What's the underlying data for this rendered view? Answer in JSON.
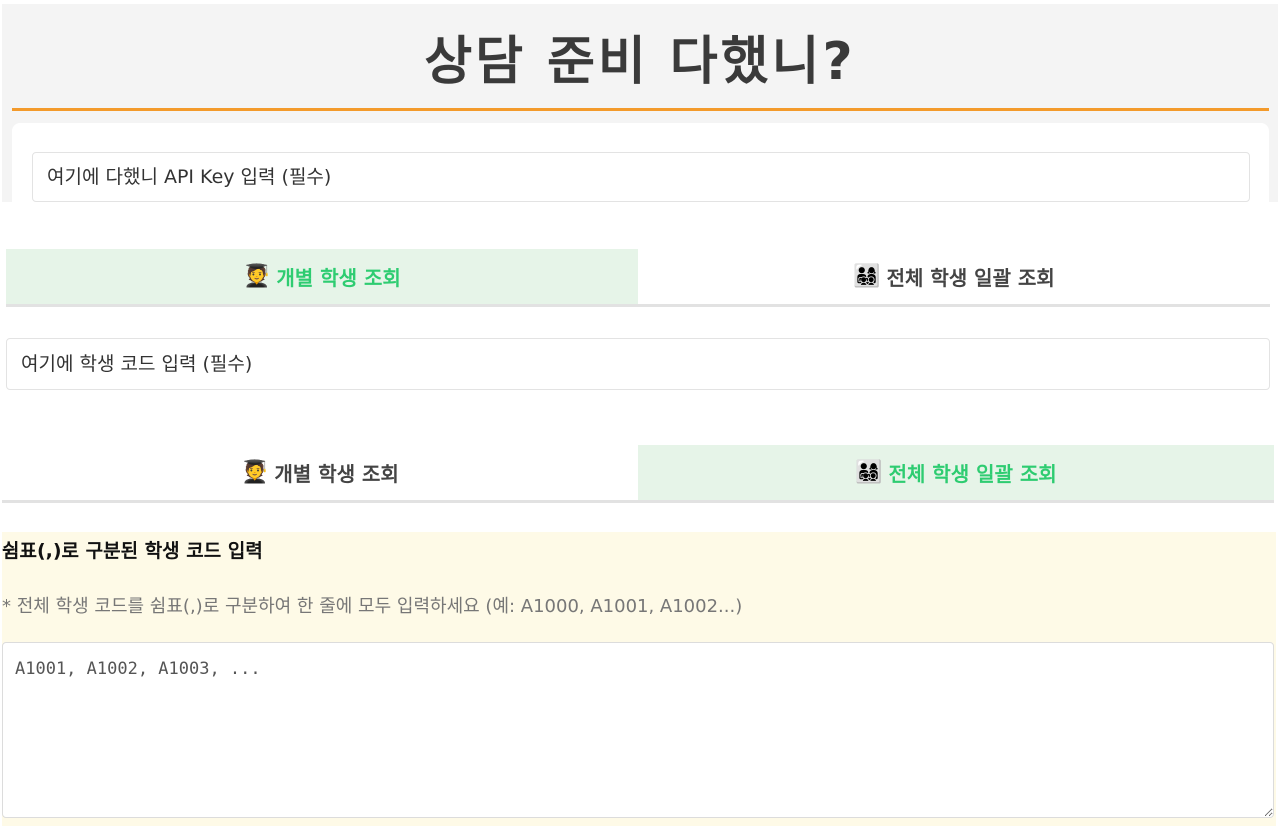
{
  "header": {
    "title": "상담 준비 다했니?"
  },
  "api_key": {
    "placeholder": "여기에 다했니 API Key 입력 (필수)"
  },
  "tabs_top": [
    {
      "icon": "🧑‍🎓",
      "icon_name": "student-icon",
      "label": "개별 학생 조회",
      "active": true
    },
    {
      "icon": "👨‍👩‍👧‍👦",
      "icon_name": "group-icon",
      "label": "전체 학생 일괄 조회",
      "active": false
    }
  ],
  "individual": {
    "placeholder": "여기에 학생 코드 입력 (필수)"
  },
  "tabs_bottom": [
    {
      "icon": "🧑‍🎓",
      "icon_name": "student-icon",
      "label": "개별 학생 조회",
      "active": false
    },
    {
      "icon": "👨‍👩‍👧‍👦",
      "icon_name": "group-icon",
      "label": "전체 학생 일괄 조회",
      "active": true
    }
  ],
  "batch": {
    "heading": "쉼표(,)로 구분된 학생 코드 입력",
    "hint": "* 전체 학생 코드를 쉼표(,)로 구분하여 한 줄에 모두 입력하세요 (예: A1000, A1001, A1002...)",
    "placeholder": "A1001, A1002, A1003, ..."
  },
  "colors": {
    "accent_orange": "#f39a2b",
    "active_green": "#2ecc71",
    "active_tab_bg": "#e6f4e8",
    "batch_panel_bg": "#fefae7"
  }
}
